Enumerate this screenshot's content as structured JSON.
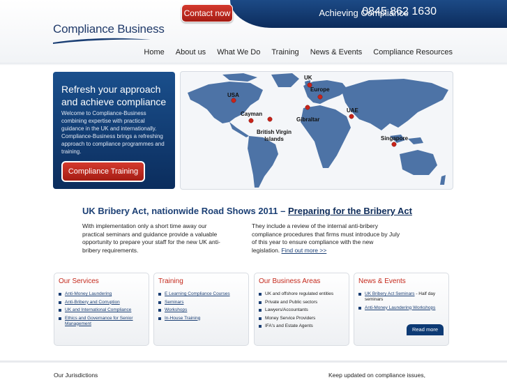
{
  "header": {
    "contact_label": "Contact now",
    "tagline": "Achieving Compliance",
    "phone": "0845 862 1630",
    "logo_text": "Compliance Business"
  },
  "nav": {
    "items": [
      "Home",
      "About us",
      "What We Do",
      "Training",
      "News & Events",
      "Compliance Resources"
    ]
  },
  "hero": {
    "title": "Refresh your approach and achieve compliance",
    "text": "Welcome to Compliance-Business combining expertise with practical guidance in the UK and internationally. Compliance-Business brings a refreshing approach to compliance programmes and training.",
    "button_label": "Compliance Training"
  },
  "map": {
    "labels": [
      "USA",
      "Cayman",
      "British Virgin Islands",
      "UK",
      "Europe",
      "Gibraltar",
      "UAE",
      "Singapore"
    ]
  },
  "headline": {
    "text": "UK Bribery Act, nationwide Road Shows 2011 – ",
    "link": "Preparing for the Bribery Act"
  },
  "intro": {
    "left": "With implementation only a short time away our practical seminars and guidance provide a valuable opportunity to prepare your staff for the new UK anti-bribery requirements.",
    "right": "They include a review of the internal anti-bribery compliance procedures that firms must introduce by July of this year to ensure compliance with the new legislation.",
    "right_link": "Find out more >>"
  },
  "boxes": {
    "services": {
      "title": "Our Services",
      "items": [
        "Anti-Money Laundering",
        "Anti-Bribery and Corruption",
        "UK and International Compliance",
        "Ethics and Governance for Senior Management"
      ]
    },
    "training": {
      "title": "Training",
      "items": [
        "E Learning Compliance Courses",
        "Seminars",
        "Workshops",
        "In-House Training"
      ]
    },
    "areas": {
      "title": "Our Business Areas",
      "items": [
        "UK and offshore regulated entities",
        "Private and Public sectors",
        "Lawyers/Accountants",
        "Money Service Providers",
        "IFA's and Estate Agents"
      ]
    },
    "news": {
      "title": "News & Events",
      "item1_link": "UK Bribery Act Seminars",
      "item1_suffix": " - Half day seminars",
      "item2_link": "Anti-Money Laundering Workshops",
      "read_more": "Read more"
    }
  },
  "footer": {
    "left": "Our Jurisdictions",
    "right": "Keep updated on compliance issues,"
  },
  "colors": {
    "navy": "#0d2b59",
    "red": "#c4291c",
    "land": "#4d73a6"
  }
}
